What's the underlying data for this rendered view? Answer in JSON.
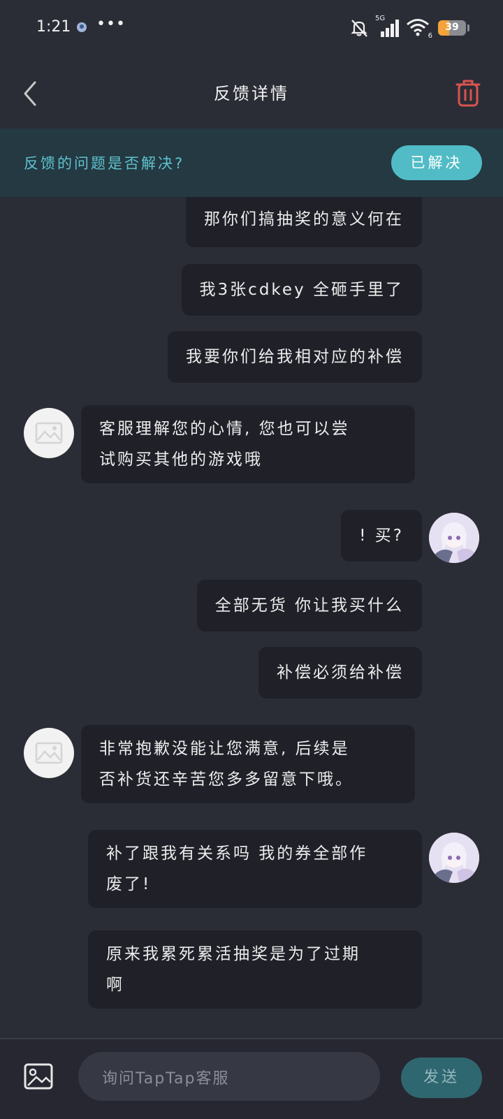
{
  "status_bar": {
    "time": "1:21",
    "dots": "•••",
    "network": "5G",
    "wifi_sub": "6",
    "battery": 39
  },
  "header": {
    "title": "反馈详情"
  },
  "banner": {
    "question": "反馈的问题是否解决?",
    "resolved_label": "已解决"
  },
  "messages": [
    {
      "from": "user",
      "text": "那你们搞抽奖的意义何在"
    },
    {
      "from": "user",
      "text": "我3张cdkey 全砸手里了"
    },
    {
      "from": "user",
      "text": "我要你们给我相对应的补偿"
    },
    {
      "from": "service",
      "lines": [
        "客服理解您的心情, 您也可以尝",
        "试购买其他的游戏哦"
      ]
    },
    {
      "from": "user",
      "text": "! 买?"
    },
    {
      "from": "user",
      "text": "全部无货 你让我买什么"
    },
    {
      "from": "user",
      "text": "补偿必须给补偿"
    },
    {
      "from": "service",
      "lines": [
        "非常抱歉没能让您满意, 后续是",
        "否补货还辛苦您多多留意下哦。"
      ]
    },
    {
      "from": "user",
      "lines": [
        "补了跟我有关系吗 我的券全部作",
        "废了!"
      ]
    },
    {
      "from": "user",
      "lines": [
        "原来我累死累活抽奖是为了过期",
        "啊"
      ]
    }
  ],
  "composer": {
    "placeholder": "询问TapTap客服",
    "send_label": "发送"
  },
  "colors": {
    "background": "#2b2d36",
    "bubble": "#1f2028",
    "accent": "#51bcc6",
    "delete": "#d9534f"
  },
  "icons": [
    "back-arrow-icon",
    "trash-icon",
    "image-icon",
    "mute-icon",
    "signal-icon",
    "wifi-icon",
    "battery-icon"
  ]
}
